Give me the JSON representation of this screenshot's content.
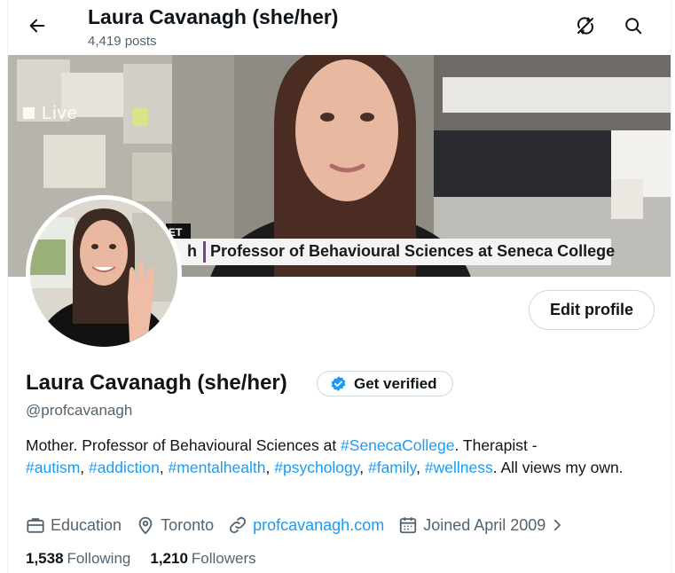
{
  "header": {
    "title": "Laura Cavanagh (she/her)",
    "posts_count": "4,419 posts"
  },
  "banner": {
    "live_label": "Live",
    "caption_fragment": "ET",
    "caption_prefix": "h",
    "caption": "Professor of Behavioural Sciences at Seneca College"
  },
  "profile": {
    "name": "Laura Cavanagh (she/her)",
    "verify_label": "Get verified",
    "handle": "@profcavanagh",
    "edit_label": "Edit profile",
    "bio": {
      "part1": "Mother. Professor of Behavioural Sciences at ",
      "tag_seneca": "#SenecaCollege",
      "part2": ". Therapist -",
      "tag_autism": "#autism",
      "tag_addiction": "#addiction",
      "tag_mentalhealth": "#mentalhealth",
      "tag_psychology": "#psychology",
      "tag_family": "#family",
      "tag_wellness": "#wellness",
      "part3": ". All views my own.",
      "sep": ", "
    },
    "meta": {
      "category": "Education",
      "location": "Toronto",
      "website": "profcavanagh.com",
      "joined": "Joined April 2009"
    },
    "stats": {
      "following_count": "1,538",
      "following_label": "Following",
      "followers_count": "1,210",
      "followers_label": "Followers"
    }
  },
  "colors": {
    "link": "#1d9bf0",
    "muted": "#536471",
    "text": "#0f1419",
    "verified_badge": "#1d9bf0"
  },
  "icons": [
    "back-arrow-icon",
    "sync-off-icon",
    "search-icon",
    "verified-badge-icon",
    "briefcase-icon",
    "location-pin-icon",
    "link-icon",
    "calendar-icon",
    "chevron-right-icon"
  ]
}
